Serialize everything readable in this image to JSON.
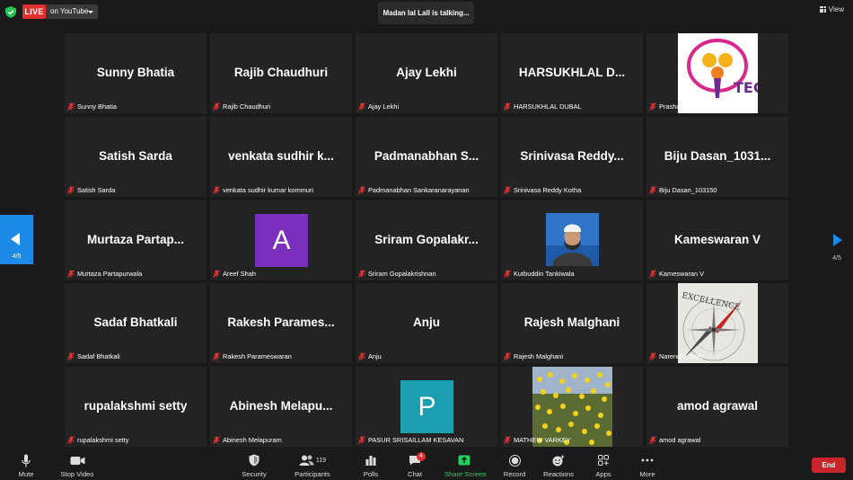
{
  "top_bar": {
    "live_label": "LIVE",
    "live_destination": "on YouTube",
    "speaker_banner": "Madan lal Lall is talking...",
    "view_label": "View"
  },
  "pagination": {
    "left_label": "4/5",
    "right_label": "4/5"
  },
  "colors": {
    "accent": "#1e8ae7",
    "live_red": "#e02f2f",
    "end_red": "#c8252b",
    "share_green": "#23d160",
    "tile_bg": "#232323",
    "avatar_a": "#7b2fbe",
    "avatar_p": "#1a9eb0"
  },
  "participants": [
    {
      "big_name": "Sunny Bhatia",
      "name": "Sunny Bhatia"
    },
    {
      "big_name": "Rajib Chaudhuri",
      "name": "Rajib Chaudhuri"
    },
    {
      "big_name": "Ajay Lekhi",
      "name": "Ajay Lekhi"
    },
    {
      "big_name": "HARSUKHLAL D...",
      "name": "HARSUKHLAL DUBAL"
    },
    {
      "big_name": "",
      "name": "Prashantha Shetty",
      "media": "tec-logo-image"
    },
    {
      "big_name": "Satish Sarda",
      "name": "Satish Sarda"
    },
    {
      "big_name": "venkata sudhir k...",
      "name": "venkata sudhir kumar kommuri"
    },
    {
      "big_name": "Padmanabhan S...",
      "name": "Padmanabhan Sankaranarayanan"
    },
    {
      "big_name": "Srinivasa Reddy...",
      "name": "Srinivasa Reddy Kotha"
    },
    {
      "big_name": "Biju Dasan_1031...",
      "name": "Biju Dasan_103150"
    },
    {
      "big_name": "Murtaza Partap...",
      "name": "Murtaza Partapurwala"
    },
    {
      "big_name": "",
      "name": "Areef Shah",
      "avatar_letter": "A"
    },
    {
      "big_name": "Sriram Gopalakr...",
      "name": "Sriram Gopalakrishnan"
    },
    {
      "big_name": "",
      "name": "Kutbuddin Tankiwala",
      "media": "profile-photo"
    },
    {
      "big_name": "Kameswaran V",
      "name": "Kameswaran V"
    },
    {
      "big_name": "Sadaf Bhatkali",
      "name": "Sadaf Bhatkali"
    },
    {
      "big_name": "Rakesh Parames...",
      "name": "Rakesh Parameswaran"
    },
    {
      "big_name": "Anju",
      "name": "Anju"
    },
    {
      "big_name": "Rajesh Malghani",
      "name": "Rajesh Malghani"
    },
    {
      "big_name": "",
      "name": "Narendra Tater",
      "media": "excellence-compass-image"
    },
    {
      "big_name": "rupalakshmi setty",
      "name": "rupalakshmi setty"
    },
    {
      "big_name": "Abinesh Melapu...",
      "name": "Abinesh Melapuram"
    },
    {
      "big_name": "",
      "name": "PASUR SRISAILLAM KESAVAN",
      "avatar_letter": "P"
    },
    {
      "big_name": "",
      "name": "MATHEW VARKEY",
      "media": "yellow-flowers-image"
    },
    {
      "big_name": "amod agrawal",
      "name": "amod agrawal"
    }
  ],
  "image_text": {
    "tec": "TEC",
    "excellence": "EXCELLENCE"
  },
  "toolbar": {
    "mute": "Mute",
    "stop_video": "Stop Video",
    "security": "Security",
    "participants": "Participants",
    "participants_count": "119",
    "polls": "Polls",
    "chat": "Chat",
    "chat_badge": "4",
    "share_screen": "Share Screen",
    "record": "Record",
    "reactions": "Reactions",
    "apps": "Apps",
    "more": "More",
    "end": "End"
  }
}
